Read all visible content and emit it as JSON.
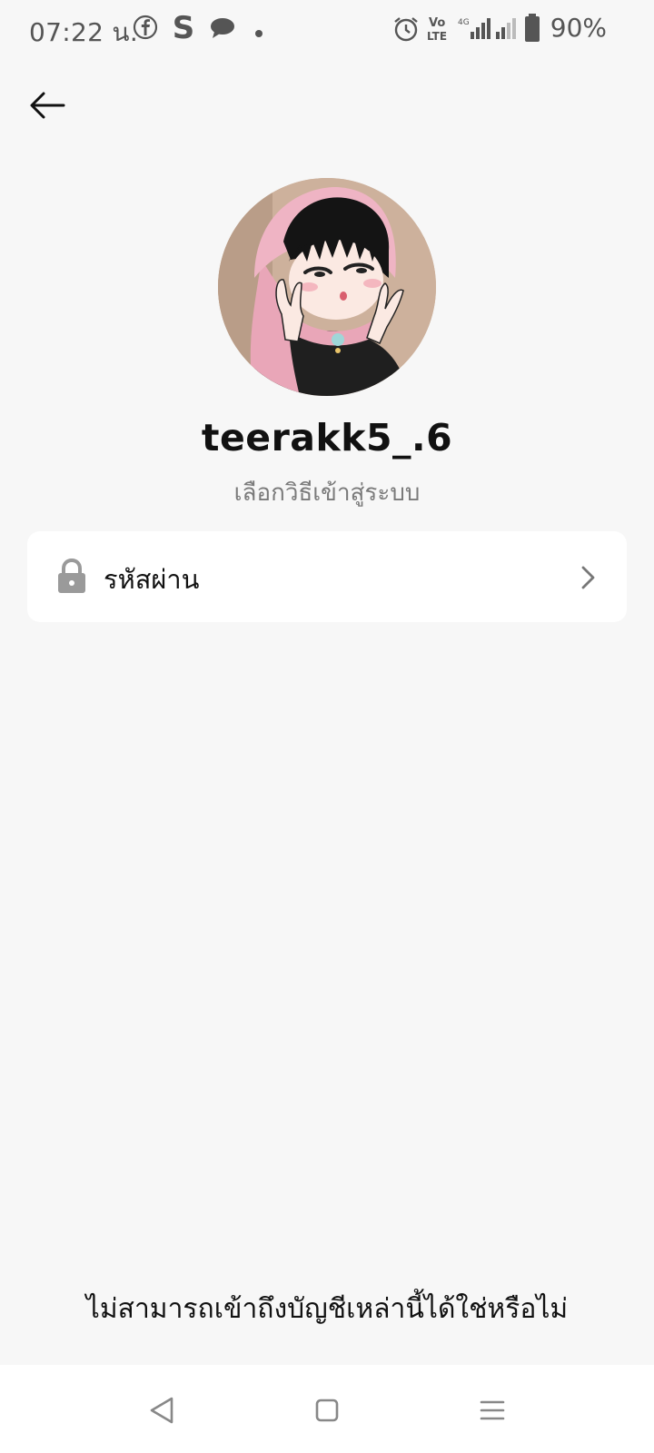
{
  "status_bar": {
    "time": "07:22 น.",
    "battery_percent": "90%",
    "notification_icons": [
      "facebook-icon",
      "skype-icon",
      "chat-icon",
      "more-dot-icon"
    ],
    "system_icons": [
      "alarm-icon",
      "volte-icon",
      "signal-4g-icon",
      "signal-icon",
      "battery-icon"
    ]
  },
  "header": {
    "back_icon": "arrow-left-icon"
  },
  "profile": {
    "username": "teerakk5_.6",
    "subtitle": "เลือกวิธีเข้าสู่ระบบ"
  },
  "login_options": [
    {
      "icon": "lock-icon",
      "label": "รหัสผ่าน",
      "trailing_icon": "chevron-right-icon"
    }
  ],
  "footer": {
    "help_link": "ไม่สามารถเข้าถึงบัญชีเหล่านี้ได้ใช่หรือไม่"
  },
  "nav_bar": {
    "buttons": [
      "back-triangle-icon",
      "home-square-icon",
      "menu-lines-icon"
    ]
  },
  "colors": {
    "background": "#f7f7f7",
    "card": "#ffffff",
    "text_primary": "#111111",
    "text_secondary": "#7a7a7a",
    "avatar_scarf": "#e9a6b8"
  }
}
